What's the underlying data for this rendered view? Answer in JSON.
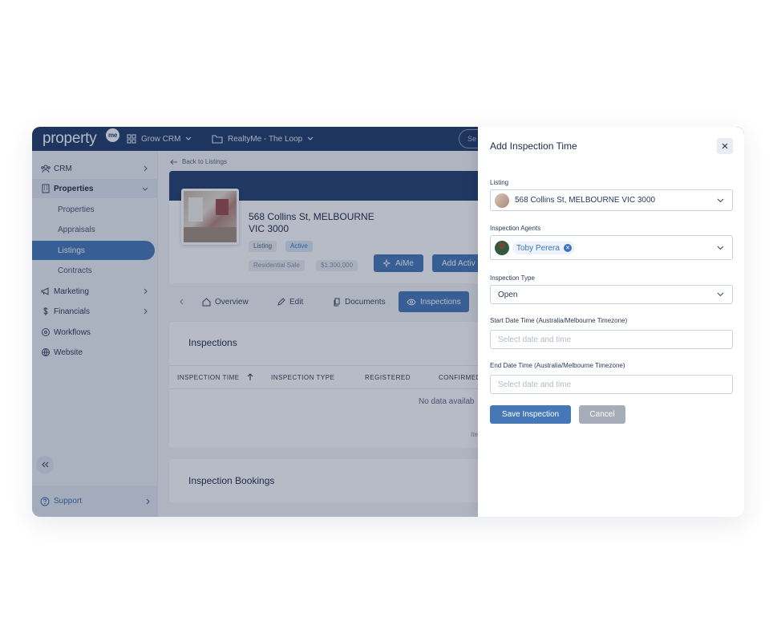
{
  "topbar": {
    "logo_text": "property",
    "logo_badge": "me",
    "grow_crm": "Grow CRM",
    "realty": "RealtyMe - The Loop",
    "search_placeholder": "Se"
  },
  "sidebar": {
    "items": [
      {
        "label": "CRM",
        "icon": "people-icon"
      },
      {
        "label": "Properties",
        "icon": "building-icon"
      },
      {
        "label": "Marketing",
        "icon": "megaphone-icon"
      },
      {
        "label": "Financials",
        "icon": "dollar-icon"
      },
      {
        "label": "Workflows",
        "icon": "workflow-icon"
      },
      {
        "label": "Website",
        "icon": "globe-icon"
      }
    ],
    "sub_items": [
      "Properties",
      "Appraisals",
      "Listings",
      "Contracts"
    ],
    "support": "Support"
  },
  "main": {
    "back_link": "Back to Listings",
    "property_title": "568 Collins St, MELBOURNE VIC 3000",
    "chip_listing": "Listing",
    "chip_active": "Active",
    "chip_type": "Residential Sale",
    "chip_price": "$1,300,000",
    "btn_aime": "AiMe",
    "btn_add_activity": "Add Activ",
    "tabs": [
      "Overview",
      "Edit",
      "Documents",
      "Inspections"
    ],
    "inspections_title": "Inspections",
    "columns": [
      "INSPECTION TIME",
      "INSPECTION TYPE",
      "REGISTERED",
      "CONFIRMED"
    ],
    "no_data": "No data availab",
    "items_text": "Ite",
    "bookings_title": "Inspection Bookings"
  },
  "drawer": {
    "title": "Add Inspection Time",
    "listing_label": "Listing",
    "listing_value": "568 Collins St, MELBOURNE VIC 3000",
    "agents_label": "Inspection Agents",
    "agent_name": "Toby Perera",
    "type_label": "Inspection Type",
    "type_value": "Open",
    "start_label": "Start Date Time (Australia/Melbourne Timezone)",
    "start_placeholder": "Select date and time",
    "end_label": "End Date Time (Australia/Melbourne Timezone)",
    "end_placeholder": "Select date and time",
    "save": "Save Inspection",
    "cancel": "Cancel"
  },
  "colors": {
    "brand_navy": "#1f3a6b",
    "accent_blue": "#4678b8",
    "overlay": "rgba(28,42,76,0.32)"
  }
}
